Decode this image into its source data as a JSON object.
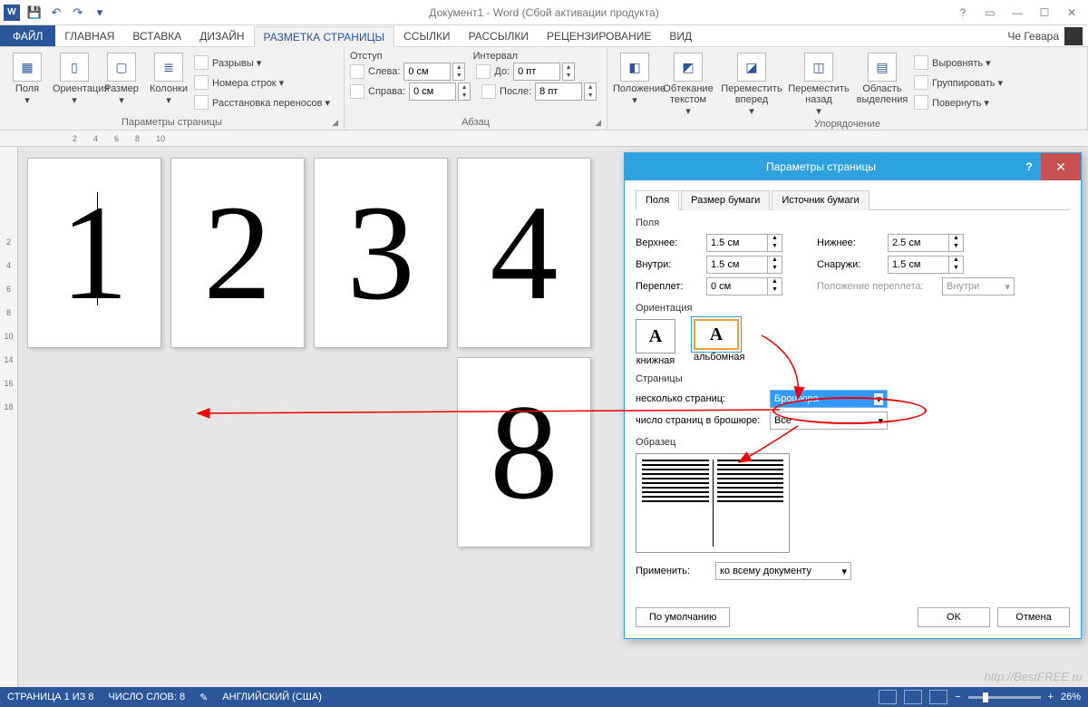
{
  "title": "Документ1 - Word (Сбой активации продукта)",
  "qat": {
    "save": "💾",
    "undo": "↶",
    "redo": "↷"
  },
  "tabs": {
    "file": "ФАЙЛ",
    "items": [
      "ГЛАВНАЯ",
      "ВСТАВКА",
      "ДИЗАЙН",
      "РАЗМЕТКА СТРАНИЦЫ",
      "ССЫЛКИ",
      "РАССЫЛКИ",
      "РЕЦЕНЗИРОВАНИЕ",
      "ВИД"
    ],
    "active_index": 3
  },
  "user": "Че Гевара",
  "ribbon": {
    "g1": {
      "label": "Параметры страницы",
      "btns": [
        "Поля",
        "Ориентация",
        "Размер",
        "Колонки"
      ],
      "small": [
        "Разрывы ▾",
        "Номера строк ▾",
        "Расстановка переносов ▾"
      ]
    },
    "g2": {
      "label": "Абзац",
      "indent_title": "Отступ",
      "spacing_title": "Интервал",
      "left": "Слева:",
      "right": "Справа:",
      "before": "До:",
      "after": "После:",
      "left_v": "0 см",
      "right_v": "0 см",
      "before_v": "0 пт",
      "after_v": "8 пт"
    },
    "g3": {
      "label": "Упорядочение",
      "btns": [
        "Положение",
        "Обтекание текстом",
        "Переместить вперед",
        "Переместить назад",
        "Область выделения"
      ],
      "small": [
        "Выровнять ▾",
        "Группировать ▾",
        "Повернуть ▾"
      ]
    }
  },
  "ruler": {
    "h": [
      "2",
      "4",
      "6",
      "8",
      "10"
    ],
    "v": [
      "2",
      "4",
      "6",
      "8",
      "10",
      "14",
      "16",
      "18"
    ]
  },
  "pages": [
    "1",
    "2",
    "3",
    "4",
    "8"
  ],
  "dialog": {
    "title": "Параметры страницы",
    "tabs": [
      "Поля",
      "Размер бумаги",
      "Источник бумаги"
    ],
    "section_margins": "Поля",
    "top": "Верхнее:",
    "top_v": "1.5 см",
    "bottom": "Нижнее:",
    "bottom_v": "2.5 см",
    "inside": "Внутри:",
    "inside_v": "1.5 см",
    "outside": "Снаружи:",
    "outside_v": "1.5 см",
    "gutter": "Переплет:",
    "gutter_v": "0 см",
    "gutter_pos": "Положение переплета:",
    "gutter_pos_v": "Внутри",
    "section_orient": "Ориентация",
    "portrait": "книжная",
    "landscape": "альбомная",
    "section_pages": "Страницы",
    "multi": "несколько страниц:",
    "multi_v": "Брошюра",
    "sheets": "число страниц в брошюре:",
    "sheets_v": "Все",
    "section_sample": "Образец",
    "apply": "Применить:",
    "apply_v": "ко всему документу",
    "default": "По умолчанию",
    "ok": "OK",
    "cancel": "Отмена"
  },
  "status": {
    "page": "СТРАНИЦА 1 ИЗ 8",
    "words": "ЧИСЛО СЛОВ: 8",
    "lang": "АНГЛИЙСКИЙ (США)",
    "zoom": "26%"
  },
  "watermark": "http://BestFREE.ru"
}
